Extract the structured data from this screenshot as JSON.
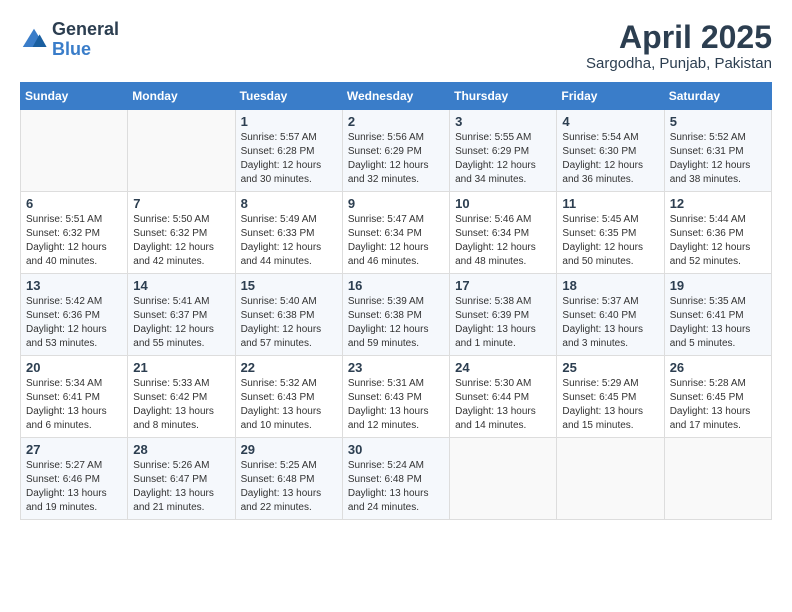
{
  "header": {
    "logo_line1": "General",
    "logo_line2": "Blue",
    "month": "April 2025",
    "location": "Sargodha, Punjab, Pakistan"
  },
  "weekdays": [
    "Sunday",
    "Monday",
    "Tuesday",
    "Wednesday",
    "Thursday",
    "Friday",
    "Saturday"
  ],
  "weeks": [
    [
      {
        "day": "",
        "info": ""
      },
      {
        "day": "",
        "info": ""
      },
      {
        "day": "1",
        "info": "Sunrise: 5:57 AM\nSunset: 6:28 PM\nDaylight: 12 hours\nand 30 minutes."
      },
      {
        "day": "2",
        "info": "Sunrise: 5:56 AM\nSunset: 6:29 PM\nDaylight: 12 hours\nand 32 minutes."
      },
      {
        "day": "3",
        "info": "Sunrise: 5:55 AM\nSunset: 6:29 PM\nDaylight: 12 hours\nand 34 minutes."
      },
      {
        "day": "4",
        "info": "Sunrise: 5:54 AM\nSunset: 6:30 PM\nDaylight: 12 hours\nand 36 minutes."
      },
      {
        "day": "5",
        "info": "Sunrise: 5:52 AM\nSunset: 6:31 PM\nDaylight: 12 hours\nand 38 minutes."
      }
    ],
    [
      {
        "day": "6",
        "info": "Sunrise: 5:51 AM\nSunset: 6:32 PM\nDaylight: 12 hours\nand 40 minutes."
      },
      {
        "day": "7",
        "info": "Sunrise: 5:50 AM\nSunset: 6:32 PM\nDaylight: 12 hours\nand 42 minutes."
      },
      {
        "day": "8",
        "info": "Sunrise: 5:49 AM\nSunset: 6:33 PM\nDaylight: 12 hours\nand 44 minutes."
      },
      {
        "day": "9",
        "info": "Sunrise: 5:47 AM\nSunset: 6:34 PM\nDaylight: 12 hours\nand 46 minutes."
      },
      {
        "day": "10",
        "info": "Sunrise: 5:46 AM\nSunset: 6:34 PM\nDaylight: 12 hours\nand 48 minutes."
      },
      {
        "day": "11",
        "info": "Sunrise: 5:45 AM\nSunset: 6:35 PM\nDaylight: 12 hours\nand 50 minutes."
      },
      {
        "day": "12",
        "info": "Sunrise: 5:44 AM\nSunset: 6:36 PM\nDaylight: 12 hours\nand 52 minutes."
      }
    ],
    [
      {
        "day": "13",
        "info": "Sunrise: 5:42 AM\nSunset: 6:36 PM\nDaylight: 12 hours\nand 53 minutes."
      },
      {
        "day": "14",
        "info": "Sunrise: 5:41 AM\nSunset: 6:37 PM\nDaylight: 12 hours\nand 55 minutes."
      },
      {
        "day": "15",
        "info": "Sunrise: 5:40 AM\nSunset: 6:38 PM\nDaylight: 12 hours\nand 57 minutes."
      },
      {
        "day": "16",
        "info": "Sunrise: 5:39 AM\nSunset: 6:38 PM\nDaylight: 12 hours\nand 59 minutes."
      },
      {
        "day": "17",
        "info": "Sunrise: 5:38 AM\nSunset: 6:39 PM\nDaylight: 13 hours\nand 1 minute."
      },
      {
        "day": "18",
        "info": "Sunrise: 5:37 AM\nSunset: 6:40 PM\nDaylight: 13 hours\nand 3 minutes."
      },
      {
        "day": "19",
        "info": "Sunrise: 5:35 AM\nSunset: 6:41 PM\nDaylight: 13 hours\nand 5 minutes."
      }
    ],
    [
      {
        "day": "20",
        "info": "Sunrise: 5:34 AM\nSunset: 6:41 PM\nDaylight: 13 hours\nand 6 minutes."
      },
      {
        "day": "21",
        "info": "Sunrise: 5:33 AM\nSunset: 6:42 PM\nDaylight: 13 hours\nand 8 minutes."
      },
      {
        "day": "22",
        "info": "Sunrise: 5:32 AM\nSunset: 6:43 PM\nDaylight: 13 hours\nand 10 minutes."
      },
      {
        "day": "23",
        "info": "Sunrise: 5:31 AM\nSunset: 6:43 PM\nDaylight: 13 hours\nand 12 minutes."
      },
      {
        "day": "24",
        "info": "Sunrise: 5:30 AM\nSunset: 6:44 PM\nDaylight: 13 hours\nand 14 minutes."
      },
      {
        "day": "25",
        "info": "Sunrise: 5:29 AM\nSunset: 6:45 PM\nDaylight: 13 hours\nand 15 minutes."
      },
      {
        "day": "26",
        "info": "Sunrise: 5:28 AM\nSunset: 6:45 PM\nDaylight: 13 hours\nand 17 minutes."
      }
    ],
    [
      {
        "day": "27",
        "info": "Sunrise: 5:27 AM\nSunset: 6:46 PM\nDaylight: 13 hours\nand 19 minutes."
      },
      {
        "day": "28",
        "info": "Sunrise: 5:26 AM\nSunset: 6:47 PM\nDaylight: 13 hours\nand 21 minutes."
      },
      {
        "day": "29",
        "info": "Sunrise: 5:25 AM\nSunset: 6:48 PM\nDaylight: 13 hours\nand 22 minutes."
      },
      {
        "day": "30",
        "info": "Sunrise: 5:24 AM\nSunset: 6:48 PM\nDaylight: 13 hours\nand 24 minutes."
      },
      {
        "day": "",
        "info": ""
      },
      {
        "day": "",
        "info": ""
      },
      {
        "day": "",
        "info": ""
      }
    ]
  ]
}
